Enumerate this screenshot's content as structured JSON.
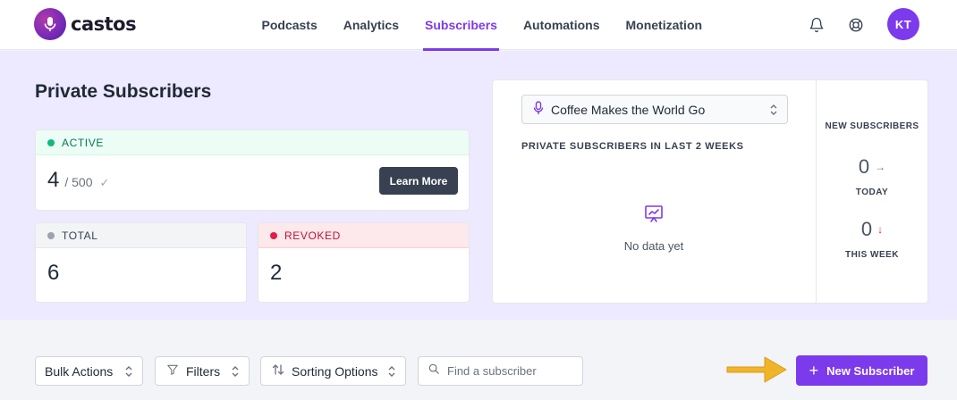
{
  "brand": {
    "name": "castos"
  },
  "nav": {
    "items": [
      {
        "label": "Podcasts"
      },
      {
        "label": "Analytics"
      },
      {
        "label": "Subscribers"
      },
      {
        "label": "Automations"
      },
      {
        "label": "Monetization"
      }
    ],
    "active": "Subscribers",
    "user_initials": "KT"
  },
  "page": {
    "title": "Private Subscribers"
  },
  "cards": {
    "active": {
      "label": "ACTIVE",
      "count": "4",
      "limit": "/ 500",
      "learn_more": "Learn More"
    },
    "total": {
      "label": "TOTAL",
      "count": "6"
    },
    "revoked": {
      "label": "REVOKED",
      "count": "2"
    }
  },
  "chart_panel": {
    "podcast_select": "Coffee Makes the World Go",
    "title": "PRIVATE SUBSCRIBERS IN LAST 2 WEEKS",
    "empty_text": "No data yet"
  },
  "new_subscribers": {
    "title": "NEW SUBSCRIBERS",
    "today": {
      "value": "0",
      "label": "TODAY"
    },
    "this_week": {
      "value": "0",
      "label": "THIS WEEK"
    }
  },
  "toolbar": {
    "bulk_actions": "Bulk Actions",
    "filters": "Filters",
    "sorting": "Sorting Options",
    "search_placeholder": "Find a subscriber",
    "new_subscriber": "New Subscriber"
  },
  "colors": {
    "accent": "#7c3aed",
    "active_green": "#10b981",
    "revoked_red": "#e11d48",
    "hero_bg": "#ede9fe",
    "hint_arrow": "#f0b429"
  }
}
